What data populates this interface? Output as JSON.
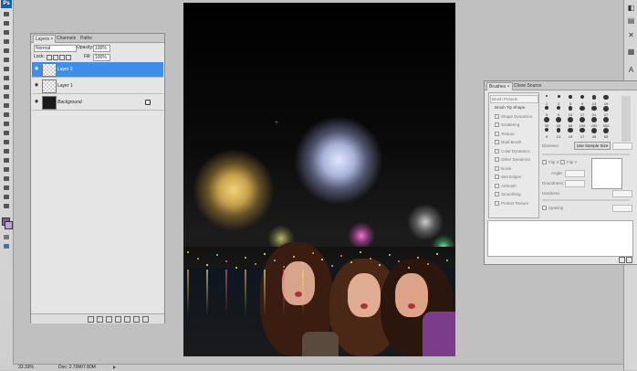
{
  "app": {
    "logo": "Ps"
  },
  "tools": [
    "move-tool",
    "marquee-tool",
    "lasso-tool",
    "magic-wand-tool",
    "crop-tool",
    "eyedropper-tool",
    "healing-brush-tool",
    "brush-tool",
    "clone-stamp-tool",
    "history-brush-tool",
    "eraser-tool",
    "gradient-tool",
    "blur-tool",
    "dodge-tool",
    "pen-tool",
    "type-tool",
    "path-selection-tool",
    "shape-tool",
    "3d-rotate-tool",
    "3d-orbit-tool",
    "hand-tool",
    "zoom-tool"
  ],
  "colors": {
    "foreground": "#7b5ea0",
    "background": "#b9a6cf",
    "selection": "#3d8ee9"
  },
  "layers_panel": {
    "tabs": [
      "Layers ×",
      "Channels",
      "Paths"
    ],
    "blend_mode": "Normal",
    "opacity_label": "Opacity:",
    "opacity_value": "100%",
    "lock_label": "Lock:",
    "fill_label": "Fill:",
    "fill_value": "100%",
    "layers": [
      {
        "name": "Layer 2",
        "selected": true
      },
      {
        "name": "Layer 1",
        "selected": false
      },
      {
        "name": "Background",
        "selected": false
      }
    ]
  },
  "brushes_panel": {
    "tabs": [
      "Brushes ×",
      "Clone Source"
    ],
    "presets_label": "Brush Presets",
    "options": [
      "Brush Tip Shape",
      "Shape Dynamics",
      "Scattering",
      "Texture",
      "Dual Brush",
      "Color Dynamics",
      "Other Dynamics",
      "Noise",
      "Wet Edges",
      "Airbrush",
      "Smoothing",
      "Protect Texture"
    ],
    "tip_sizes": [
      "1",
      "3",
      "5",
      "9",
      "13",
      "19",
      "5",
      "9",
      "13",
      "17",
      "21",
      "27",
      "35",
      "45",
      "65",
      "100",
      "200",
      "300",
      "9",
      "13",
      "19",
      "17",
      "45",
      "65"
    ],
    "diameter_label": "Diameter",
    "sample_size_button": "Use Sample Size",
    "flip_x": "Flip X",
    "flip_y": "Flip Y",
    "angle_label": "Angle:",
    "roundness_label": "Roundness:",
    "hardness_label": "Hardness",
    "spacing_label": "Spacing"
  },
  "status": {
    "zoom": "33.33%",
    "doc": "Doc: 2.70M/7.80M"
  }
}
